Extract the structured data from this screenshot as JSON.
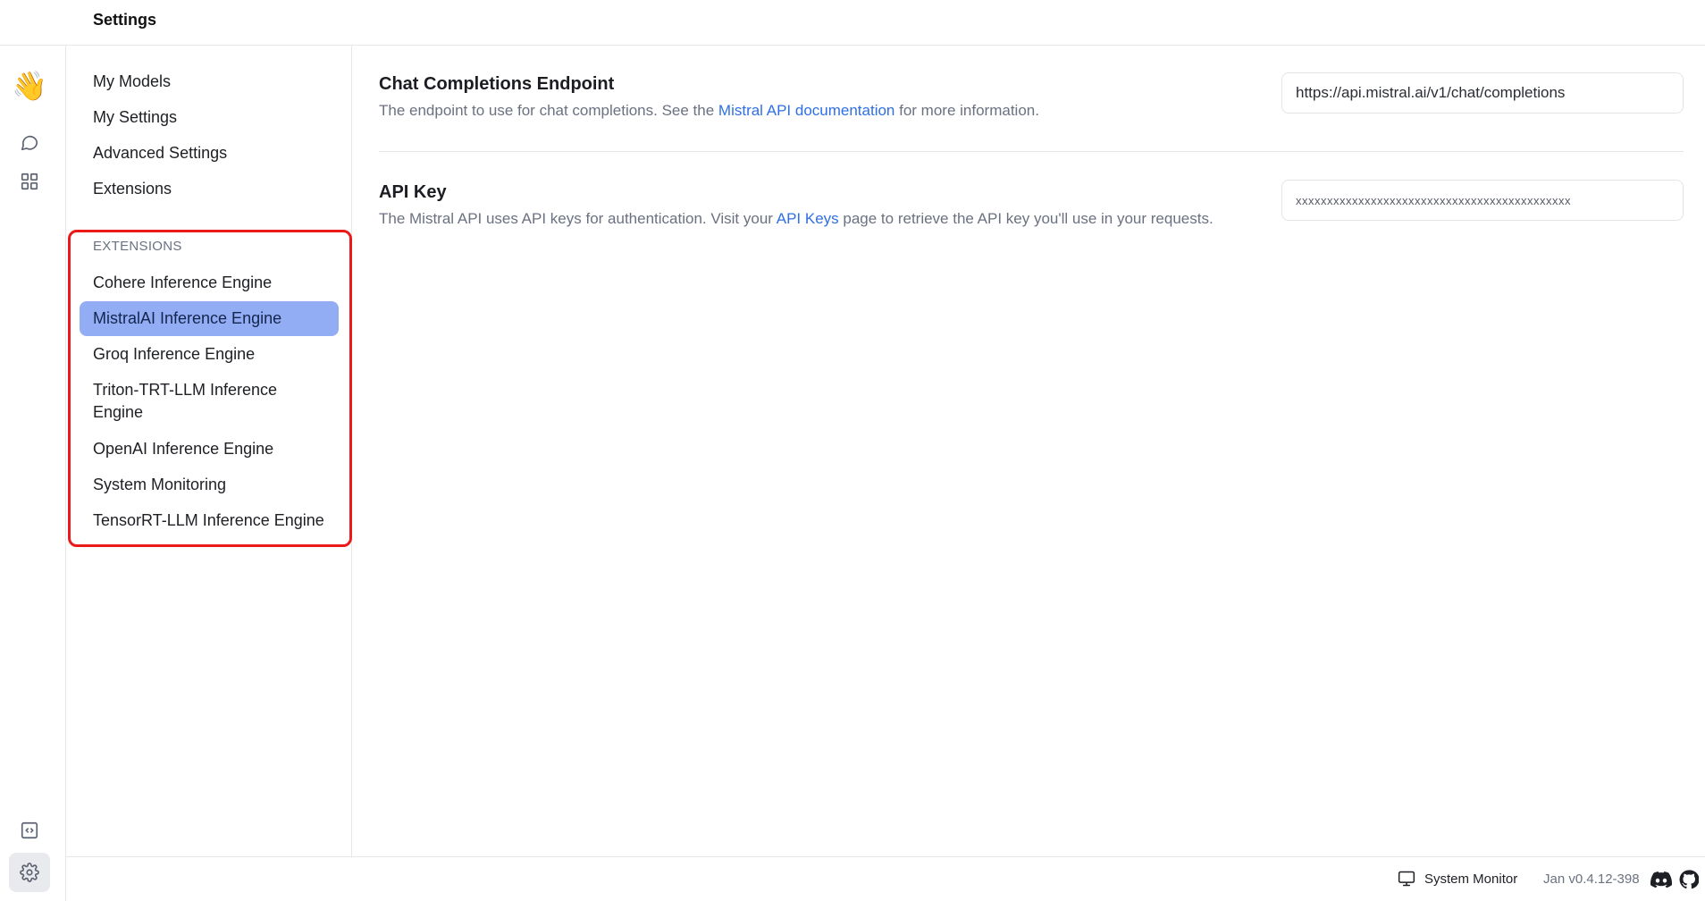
{
  "window": {
    "title": "Settings"
  },
  "rail": {
    "items": [
      {
        "name": "wave-icon",
        "glyph": "👋"
      },
      {
        "name": "chat-icon"
      },
      {
        "name": "hub-icon"
      },
      {
        "name": "api-server-icon"
      },
      {
        "name": "settings-icon",
        "active": true
      }
    ]
  },
  "sidebar": {
    "nav": [
      "My Models",
      "My Settings",
      "Advanced Settings",
      "Extensions"
    ],
    "extensions_header": "EXTENSIONS",
    "extensions": [
      {
        "label": "Cohere Inference Engine",
        "active": false
      },
      {
        "label": "MistralAI Inference Engine",
        "active": true
      },
      {
        "label": "Groq Inference Engine",
        "active": false
      },
      {
        "label": "Triton-TRT-LLM Inference Engine",
        "active": false
      },
      {
        "label": "OpenAI Inference Engine",
        "active": false
      },
      {
        "label": "System Monitoring",
        "active": false
      },
      {
        "label": "TensorRT-LLM Inference Engine",
        "active": false
      }
    ]
  },
  "main": {
    "endpoint": {
      "title": "Chat Completions Endpoint",
      "desc_before": "The endpoint to use for chat completions. See the ",
      "desc_link": "Mistral API documentation",
      "desc_after": " for more information.",
      "value": "https://api.mistral.ai/v1/chat/completions"
    },
    "api_key": {
      "title": "API Key",
      "desc_before": "The Mistral API uses API keys for authentication. Visit your ",
      "desc_link": "API Keys",
      "desc_after": " page to retrieve the API key you'll use in your requests.",
      "value": "xxxxxxxxxxxxxxxxxxxxxxxxxxxxxxxxxxxxxxxxxxxx"
    }
  },
  "statusbar": {
    "system_monitor": "System Monitor",
    "version": "Jan v0.4.12-398"
  },
  "colors": {
    "active_item_bg": "#93adf4",
    "highlight_border": "#ea1a1a",
    "link": "#2f6fe4"
  }
}
